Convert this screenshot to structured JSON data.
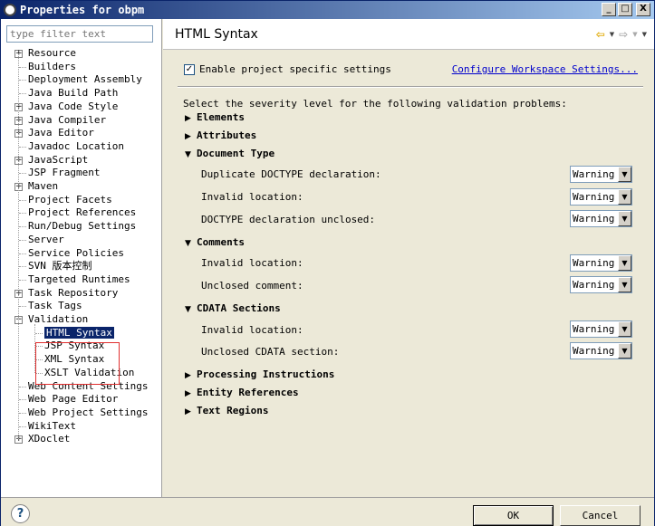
{
  "window": {
    "title": "Properties for obpm",
    "minimize": "_",
    "maximize": "□",
    "close": "X"
  },
  "filter": {
    "placeholder": "type filter text"
  },
  "tree": [
    {
      "label": "Resource",
      "expander": "+"
    },
    {
      "label": "Builders"
    },
    {
      "label": "Deployment Assembly"
    },
    {
      "label": "Java Build Path"
    },
    {
      "label": "Java Code Style",
      "expander": "+"
    },
    {
      "label": "Java Compiler",
      "expander": "+"
    },
    {
      "label": "Java Editor",
      "expander": "+"
    },
    {
      "label": "Javadoc Location"
    },
    {
      "label": "JavaScript",
      "expander": "+"
    },
    {
      "label": "JSP Fragment"
    },
    {
      "label": "Maven",
      "expander": "+"
    },
    {
      "label": "Project Facets"
    },
    {
      "label": "Project References"
    },
    {
      "label": "Run/Debug Settings"
    },
    {
      "label": "Server"
    },
    {
      "label": "Service Policies"
    },
    {
      "label": "SVN 版本控制"
    },
    {
      "label": "Targeted Runtimes"
    },
    {
      "label": "Task Repository",
      "expander": "+"
    },
    {
      "label": "Task Tags"
    },
    {
      "label": "Validation",
      "expander": "−"
    },
    {
      "label": "HTML Syntax",
      "child": true,
      "selected": true
    },
    {
      "label": "JSP Syntax",
      "child": true
    },
    {
      "label": "XML Syntax",
      "child": true
    },
    {
      "label": "XSLT Validation",
      "child": true
    },
    {
      "label": "Web Content Settings"
    },
    {
      "label": "Web Page Editor"
    },
    {
      "label": "Web Project Settings"
    },
    {
      "label": "WikiText"
    },
    {
      "label": "XDoclet",
      "expander": "+"
    }
  ],
  "page": {
    "title": "HTML Syntax",
    "nav": {
      "back": "⇦",
      "forward": "⇨",
      "dropdown": "▼",
      "menu": "▼"
    },
    "enable_checked": "✓",
    "enable_label": "Enable project specific settings",
    "configure_link": "Configure Workspace Settings...",
    "severity_intro": "Select the severity level for the following validation problems:",
    "sections": {
      "elements": {
        "tri": "▶",
        "label": "Elements"
      },
      "attributes": {
        "tri": "▶",
        "label": "Attributes"
      },
      "document_type": {
        "tri": "▼",
        "label": "Document Type"
      },
      "comments": {
        "tri": "▼",
        "label": "Comments"
      },
      "cdata": {
        "tri": "▼",
        "label": "CDATA Sections"
      },
      "processing": {
        "tri": "▶",
        "label": "Processing Instructions"
      },
      "entity": {
        "tri": "▶",
        "label": "Entity References"
      },
      "text_regions": {
        "tri": "▶",
        "label": "Text Regions"
      }
    },
    "options": {
      "dup_doctype": {
        "label": "Duplicate DOCTYPE declaration:",
        "value": "Warning"
      },
      "doctype_invalid_location": {
        "label": "Invalid location:",
        "value": "Warning"
      },
      "doctype_unclosed": {
        "label": "DOCTYPE declaration unclosed:",
        "value": "Warning"
      },
      "comment_invalid_location": {
        "label": "Invalid location:",
        "value": "Warning"
      },
      "comment_unclosed": {
        "label": "Unclosed comment:",
        "value": "Warning"
      },
      "cdata_invalid_location": {
        "label": "Invalid location:",
        "value": "Warning"
      },
      "cdata_unclosed": {
        "label": "Unclosed CDATA section:",
        "value": "Warning"
      }
    }
  },
  "footer": {
    "help": "?",
    "ok": "OK",
    "cancel": "Cancel"
  }
}
